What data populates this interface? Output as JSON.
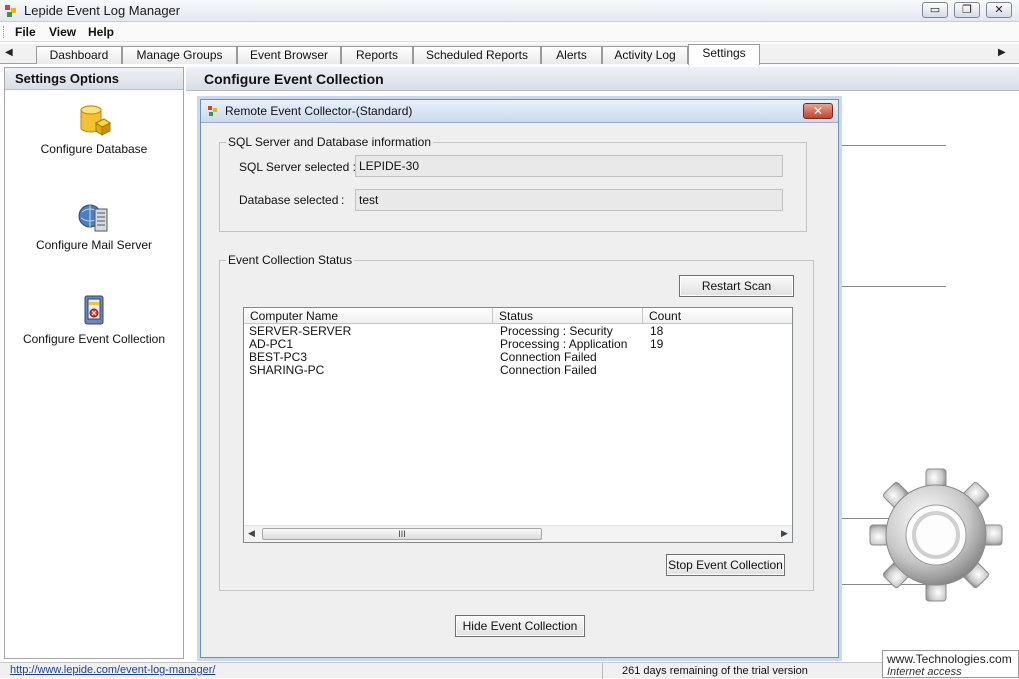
{
  "window": {
    "title": "Lepide Event Log Manager",
    "minimize_glyph": "▭",
    "restore_glyph": "❐",
    "close_glyph": "✕"
  },
  "menu": [
    "File",
    "View",
    "Help"
  ],
  "tabs": {
    "left_arrow": "◀",
    "right_arrow": "▶",
    "items": [
      "Dashboard",
      "Manage Groups",
      "Event Browser",
      "Reports",
      "Scheduled Reports",
      "Alerts",
      "Activity Log",
      "Settings"
    ],
    "active": "Settings"
  },
  "left_pane": {
    "header": "Settings Options",
    "options": [
      "Configure Database",
      "Configure Mail Server",
      "Configure Event Collection"
    ]
  },
  "main": {
    "header": "Configure Event Collection"
  },
  "dialog": {
    "title": "Remote Event Collector-(Standard)",
    "close_glyph": "✕",
    "sql_group": {
      "legend": "SQL Server and Database information",
      "server_label": "SQL Server selected :",
      "server_value": "LEPIDE-30",
      "database_label": "Database selected",
      "database_colon": ":",
      "database_value": "test"
    },
    "status_group": {
      "legend": "Event Collection Status",
      "restart_button": "Restart Scan",
      "stop_button": "Stop Event Collection",
      "columns": [
        "Computer Name",
        "Status",
        "Count"
      ],
      "rows": [
        [
          "SERVER-SERVER",
          "Processing : Security",
          "18"
        ],
        [
          "AD-PC1",
          "Processing : Application",
          "19"
        ],
        [
          "BEST-PC3",
          "Connection Failed",
          ""
        ],
        [
          "SHARING-PC",
          "Connection Failed",
          ""
        ]
      ],
      "scroll_left": "◀",
      "scroll_right": "▶",
      "scroll_grip": "III"
    },
    "hide_button": "Hide Event Collection"
  },
  "status_bar": {
    "link": "http://www.lepide.com/event-log-manager/",
    "trial": "261 days remaining of the trial version"
  },
  "watermark": {
    "line1": "www.Technologies.com",
    "line2": "Internet access"
  },
  "colors": {
    "accent": "#c9daee",
    "close_red": "#c1442b",
    "link": "#1a3fa8"
  },
  "icons": [
    "app-logo-icon",
    "database-icon",
    "mail-server-icon",
    "event-collection-icon",
    "gear-icon"
  ]
}
